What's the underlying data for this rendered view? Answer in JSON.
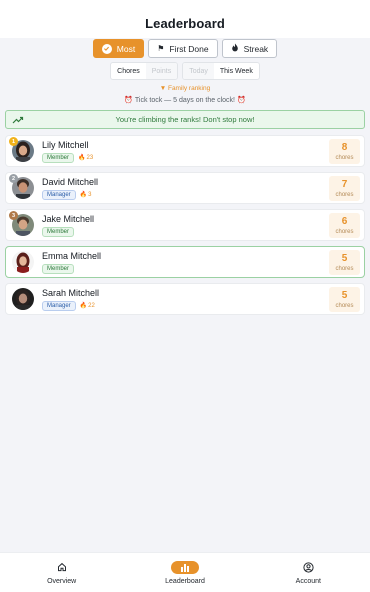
{
  "header": {
    "title": "Leaderboard"
  },
  "modes": [
    {
      "label": "Most",
      "active": true
    },
    {
      "label": "First Done",
      "active": false
    },
    {
      "label": "Streak",
      "active": false
    }
  ],
  "filters": {
    "metric": [
      {
        "label": "Chores",
        "disabled": false
      },
      {
        "label": "Points",
        "disabled": true
      }
    ],
    "period": [
      {
        "label": "Today",
        "disabled": true
      },
      {
        "label": "This Week",
        "disabled": false
      }
    ]
  },
  "captions": {
    "family_ranking": "▼ Family ranking",
    "countdown": "Tick tock — 5 days on the clock!"
  },
  "banner": {
    "text": "You're climbing the ranks! Don't stop now!"
  },
  "leaderboard": [
    {
      "rank": "1",
      "name": "Lily Mitchell",
      "role": "Member",
      "streak": "23",
      "count": "8",
      "unit": "chores"
    },
    {
      "rank": "2",
      "name": "David Mitchell",
      "role": "Manager",
      "streak": "3",
      "count": "7",
      "unit": "chores"
    },
    {
      "rank": "3",
      "name": "Jake Mitchell",
      "role": "Member",
      "streak": "",
      "count": "6",
      "unit": "chores"
    },
    {
      "rank": "",
      "name": "Emma Mitchell",
      "role": "Member",
      "streak": "",
      "count": "5",
      "unit": "chores"
    },
    {
      "rank": "",
      "name": "Sarah Mitchell",
      "role": "Manager",
      "streak": "22",
      "count": "5",
      "unit": "chores"
    }
  ],
  "nav": [
    {
      "label": "Overview",
      "icon": "home-icon"
    },
    {
      "label": "Leaderboard",
      "icon": "bar-chart-icon"
    },
    {
      "label": "Account",
      "icon": "account-icon"
    }
  ],
  "colors": {
    "accent": "#e7922b",
    "success": "#2f7a3c",
    "gold": "#f1b31c",
    "silver": "#9aa0a6",
    "bronze": "#b07a4a"
  }
}
